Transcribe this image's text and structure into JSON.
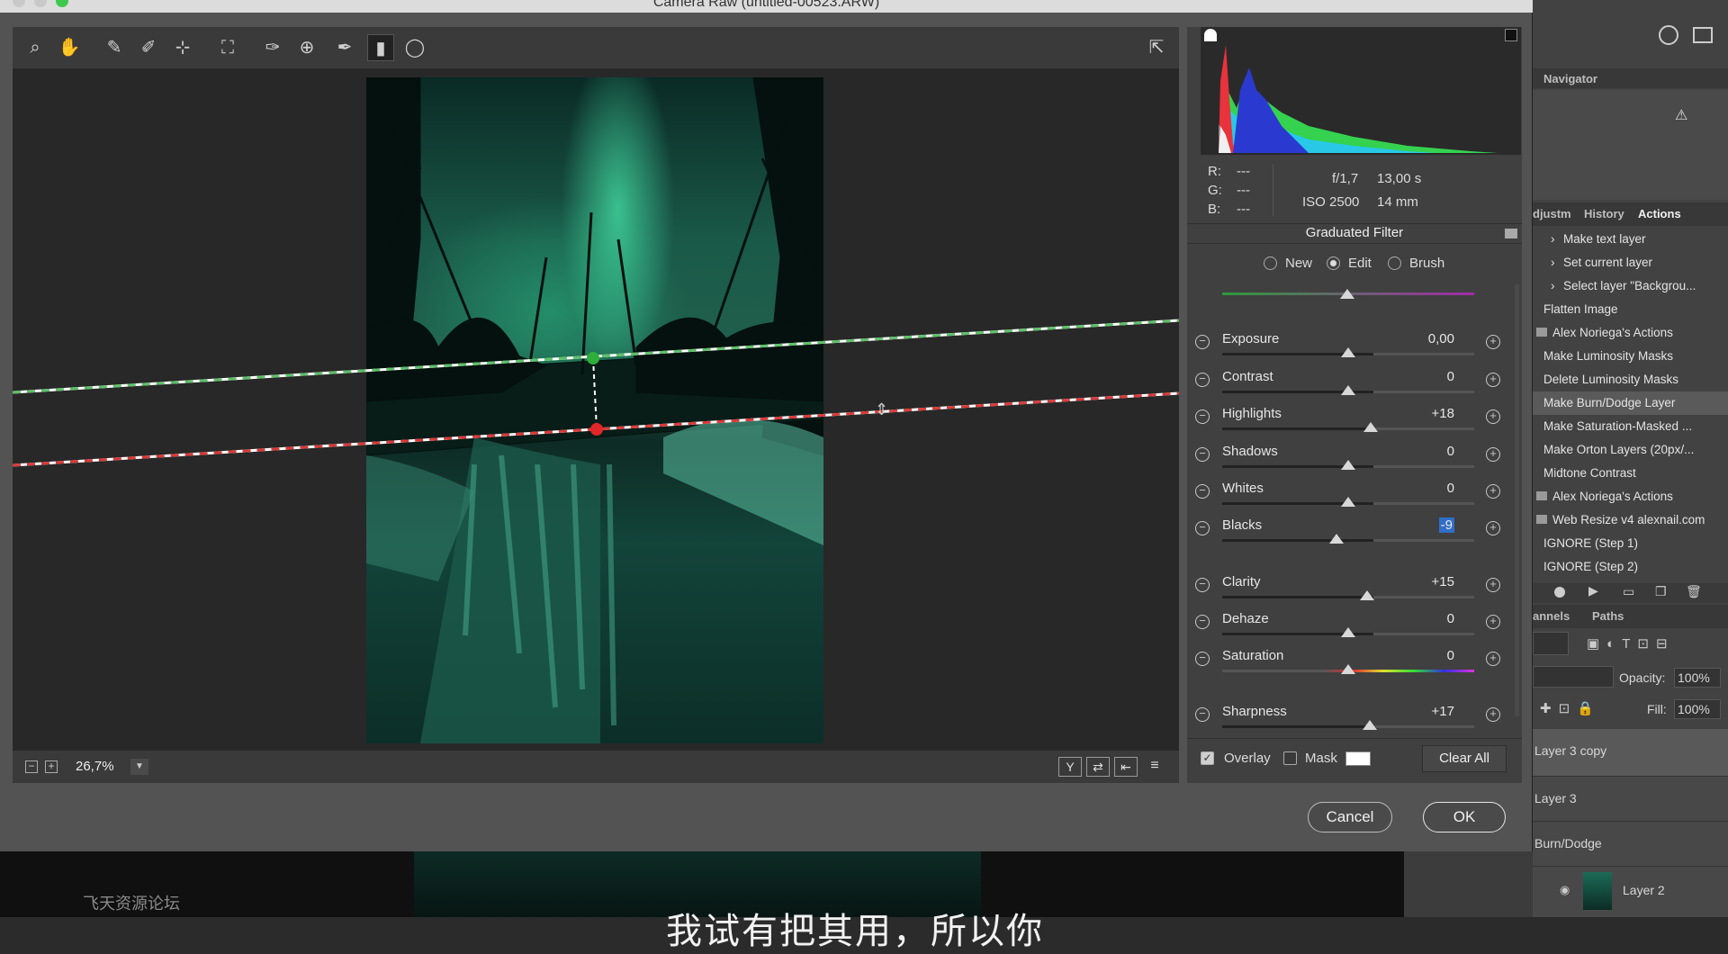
{
  "window_title": "Camera Raw (untitled-00523.ARW)",
  "toolbar_icons": [
    "zoom-icon",
    "hand-icon",
    "white-balance-icon",
    "color-sampler-icon",
    "targeted-adjustment-icon",
    "crop-icon",
    "spot-removal-icon",
    "red-eye-icon",
    "adjustment-brush-icon",
    "graduated-filter-icon",
    "radial-filter-icon"
  ],
  "camera_info": {
    "r": "R:",
    "g": "G:",
    "b": "B:",
    "r_val": "---",
    "g_val": "---",
    "b_val": "---",
    "aperture": "f/1,7",
    "shutter": "13,00 s",
    "iso": "ISO 2500",
    "focal": "14 mm"
  },
  "panel_title": "Graduated Filter",
  "mode": {
    "new": "New",
    "edit": "Edit",
    "brush": "Brush",
    "selected": "edit"
  },
  "sliders": [
    {
      "name": "Exposure",
      "value": "0,00",
      "pos": 0.5
    },
    {
      "name": "Contrast",
      "value": "0",
      "pos": 0.5
    },
    {
      "name": "Highlights",
      "value": "+18",
      "pos": 0.59
    },
    {
      "name": "Shadows",
      "value": "0",
      "pos": 0.5
    },
    {
      "name": "Whites",
      "value": "0",
      "pos": 0.5
    },
    {
      "name": "Blacks",
      "value": "-9",
      "pos": 0.455
    },
    {
      "name": "Clarity",
      "value": "+15",
      "pos": 0.575
    },
    {
      "name": "Dehaze",
      "value": "0",
      "pos": 0.5
    },
    {
      "name": "Saturation",
      "value": "0",
      "pos": 0.5
    },
    {
      "name": "Sharpness",
      "value": "+17",
      "pos": 0.585
    }
  ],
  "overlay_label": "Overlay",
  "mask_label": "Mask",
  "clear_all_label": "Clear All",
  "zoom_level": "26,7%",
  "cancel_label": "Cancel",
  "ok_label": "OK",
  "ps_panels": {
    "navigator": "Navigator",
    "tabs": [
      "djustm",
      "History",
      "Actions"
    ],
    "actions": [
      {
        "label": "Make text layer",
        "chev": true
      },
      {
        "label": "Set current layer",
        "chev": true
      },
      {
        "label": "Select layer \"Backgrou...",
        "chev": true
      },
      {
        "label": "Flatten Image",
        "chev": false
      },
      {
        "label": "Alex Noriega's Actions",
        "folder": true
      },
      {
        "label": "Make Luminosity Masks"
      },
      {
        "label": "Delete Luminosity Masks"
      },
      {
        "label": "Make Burn/Dodge Layer",
        "hl": true
      },
      {
        "label": "Make Saturation-Masked ..."
      },
      {
        "label": "Make Orton Layers (20px/..."
      },
      {
        "label": "Midtone Contrast"
      },
      {
        "label": "Alex Noriega's Actions",
        "folder": true
      },
      {
        "label": "Web Resize v4 alexnail.com",
        "folder": true
      },
      {
        "label": "IGNORE (Step 1)"
      },
      {
        "label": "IGNORE (Step 2)"
      }
    ],
    "channels_tabs": [
      "annels",
      "Paths"
    ],
    "opacity_label": "Opacity:",
    "opacity_value": "100%",
    "fill_label": "Fill:",
    "fill_value": "100%",
    "layers": [
      "Layer 3 copy",
      "Layer 3",
      "Burn/Dodge",
      "Layer 2"
    ]
  },
  "watermark": "飞天资源论坛",
  "subtitle": "我试有把其用，所以你"
}
